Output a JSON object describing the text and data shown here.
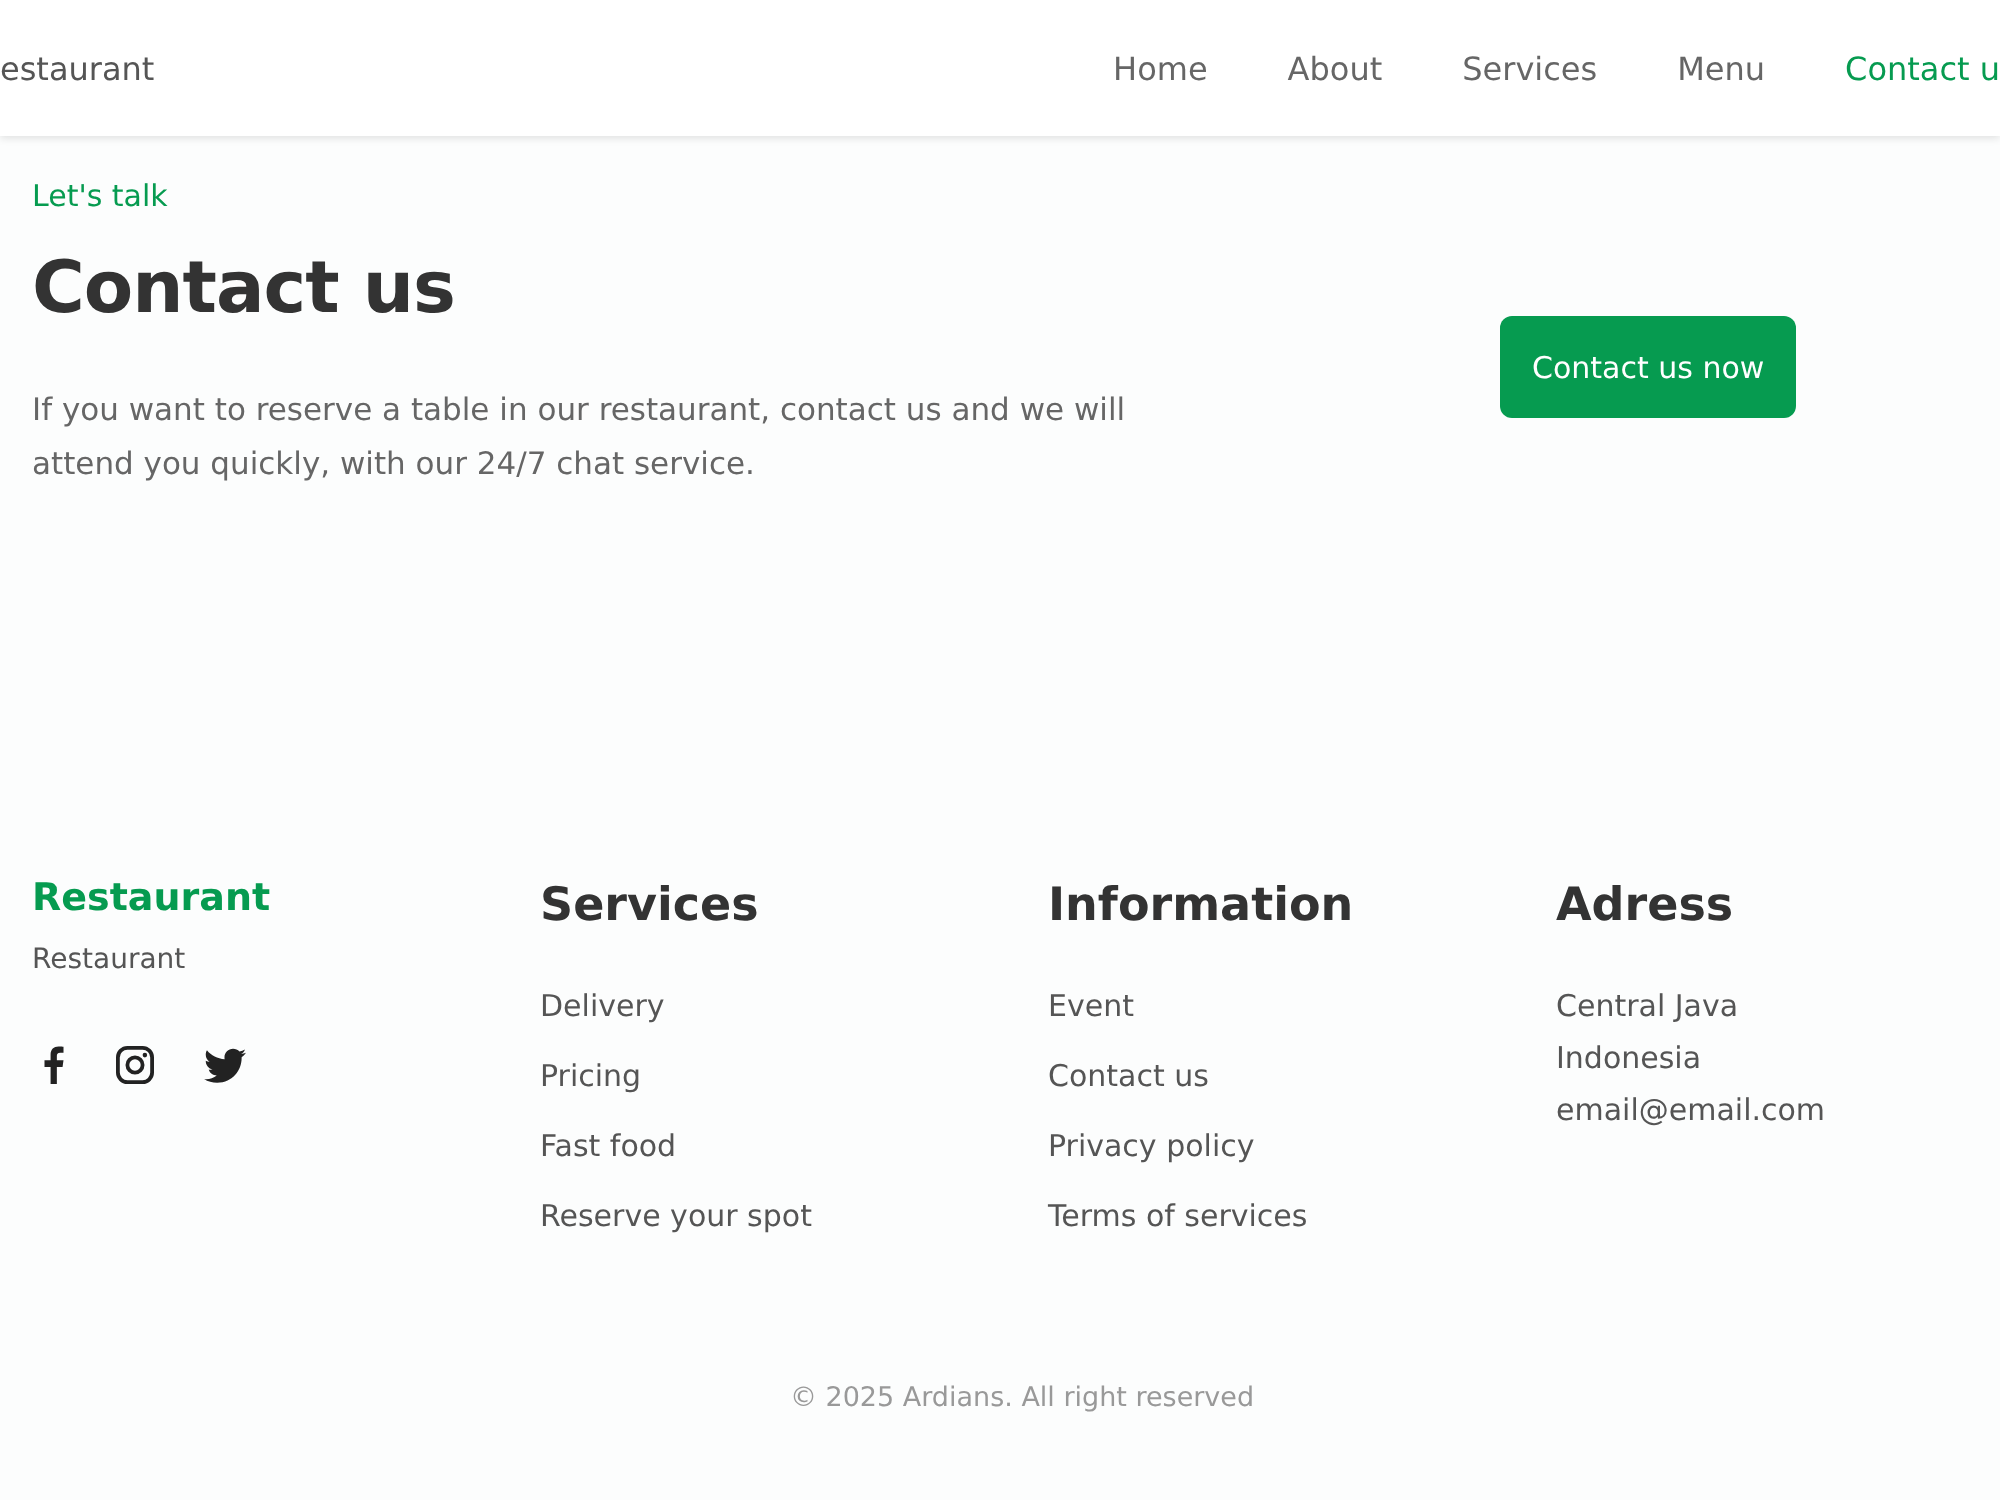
{
  "header": {
    "logo": "estaurant",
    "nav": [
      {
        "label": "Home",
        "selected": false
      },
      {
        "label": "About",
        "selected": false
      },
      {
        "label": "Services",
        "selected": false
      },
      {
        "label": "Menu",
        "selected": false
      },
      {
        "label": "Contact u",
        "selected": true
      }
    ]
  },
  "hero": {
    "eyebrow": "Let's talk",
    "title": "Contact us",
    "text": "If you want to reserve a table in our restaurant, contact us and we will attend you quickly, with our 24/7 chat service.",
    "button": "Contact us now"
  },
  "footer": {
    "brand": {
      "name": "Restaurant",
      "tagline": "Restaurant"
    },
    "columns": [
      {
        "title": "Services",
        "kind": "links",
        "items": [
          "Delivery",
          "Pricing",
          "Fast food",
          "Reserve your spot"
        ]
      },
      {
        "title": "Information",
        "kind": "links",
        "items": [
          "Event",
          "Contact us",
          "Privacy policy",
          "Terms of services"
        ]
      },
      {
        "title": "Adress",
        "kind": "address",
        "items": [
          "Central Java",
          "Indonesia",
          "email@email.com"
        ]
      }
    ],
    "copyright": "© 2025 Ardians. All right reserved"
  }
}
